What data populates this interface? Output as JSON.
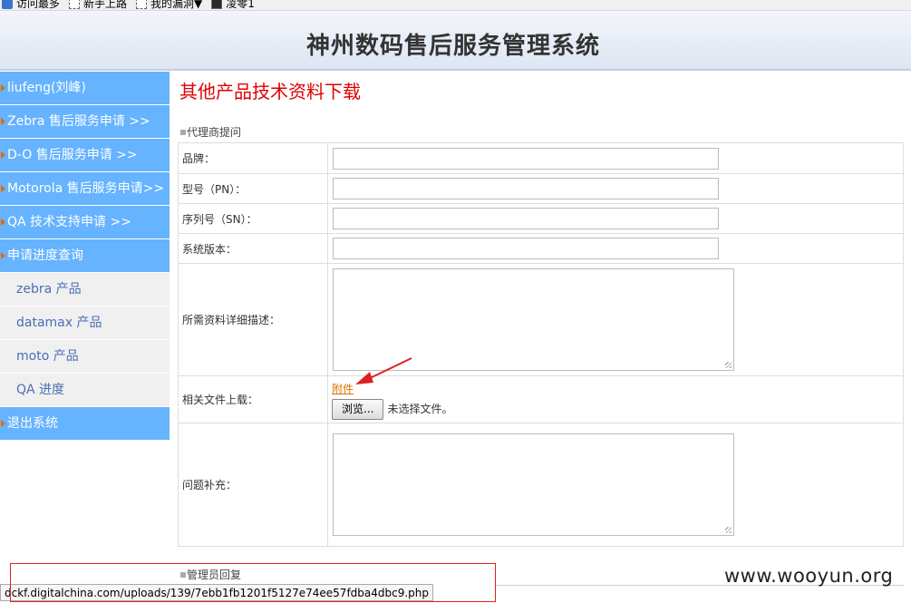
{
  "favorites_bar": {
    "items": [
      {
        "label": "访问最多",
        "icon": "blue-app-icon"
      },
      {
        "label": "新手上路",
        "icon": "page-icon"
      },
      {
        "label": "我的漏洞▼",
        "icon": "page-icon"
      },
      {
        "label": "凌零1",
        "icon": "image-icon"
      }
    ]
  },
  "header": {
    "title": "神州数码售后服务管理系统"
  },
  "sidebar": {
    "items": [
      {
        "label": "liufeng(刘峰)"
      },
      {
        "label": "Zebra 售后服务申请 >>"
      },
      {
        "label": "D-O 售后服务申请 >>"
      },
      {
        "label": "Motorola 售后服务申请>>"
      },
      {
        "label": "QA 技术支持申请 >>"
      },
      {
        "label": "申请进度查询"
      },
      {
        "label": "zebra 产品"
      },
      {
        "label": "datamax 产品"
      },
      {
        "label": "moto 产品"
      },
      {
        "label": "QA 进度"
      },
      {
        "label": "退出系统"
      }
    ]
  },
  "main": {
    "title": "其他产品技术资料下载",
    "section_question": "代理商提问",
    "section_reply": "管理员回复",
    "form": {
      "brand_label": "品牌：",
      "model_label": "型号（PN）：",
      "serial_label": "序列号（SN）：",
      "version_label": "系统版本：",
      "description_label": "所需资料详细描述：",
      "upload_label": "相关文件上载：",
      "attachment_link": "附件",
      "browse_button": "浏览...",
      "no_file_text": "未选择文件。",
      "supplement_label": "问题补充："
    }
  },
  "status_bar": {
    "url": "dckf.digitalchina.com/uploads/139/7ebb1fb1201f5127e74ee57fdba4dbc9.php"
  },
  "watermark": "www.wooyun.org",
  "colors": {
    "menu_blue": "#66b3ff",
    "submenu_bg": "#f0f0f0",
    "title_red": "#e00000",
    "link_orange": "#e07000",
    "annotation_red": "#e02020"
  }
}
